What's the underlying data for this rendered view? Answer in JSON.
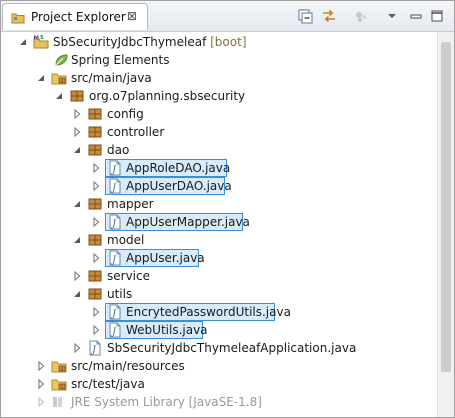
{
  "view": {
    "tab_title": "Project Explorer",
    "close_glyph": "⊠"
  },
  "toolbar": {
    "collapse_all_icon": "collapse-all-icon",
    "link_editor_icon": "link-with-editor-icon",
    "focus_icon": "focus-on-active-task-icon",
    "view_menu_icon": "view-menu-icon",
    "minimize_icon": "minimize-icon",
    "maximize_icon": "maximize-icon"
  },
  "tree": {
    "project": {
      "name": "SbSecurityJdbcThymeleaf",
      "decoration": "[boot]"
    },
    "spring_elements": "Spring Elements",
    "src_main_java": "src/main/java",
    "package_root": "org.o7planning.sbsecurity",
    "config": "config",
    "controller": "controller",
    "dao": "dao",
    "app_role_dao": "AppRoleDAO.java",
    "app_user_dao": "AppUserDAO.java",
    "mapper": "mapper",
    "app_user_mapper": "AppUserMapper.java",
    "model": "model",
    "app_user": "AppUser.java",
    "service": "service",
    "utils": "utils",
    "encrypted_password_utils": "EncrytedPasswordUtils.java",
    "web_utils": "WebUtils.java",
    "application": "SbSecurityJdbcThymeleafApplication.java",
    "src_main_resources": "src/main/resources",
    "src_test_java": "src/test/java",
    "jre_partial": "JRE System Library [JavaSE-1.8]"
  },
  "colors": {
    "selection_border": "#3c8fd3",
    "selection_fill": "#d7ebfa",
    "package_brown": "#9c6b2e",
    "folder_yellow": "#e8c15a"
  }
}
